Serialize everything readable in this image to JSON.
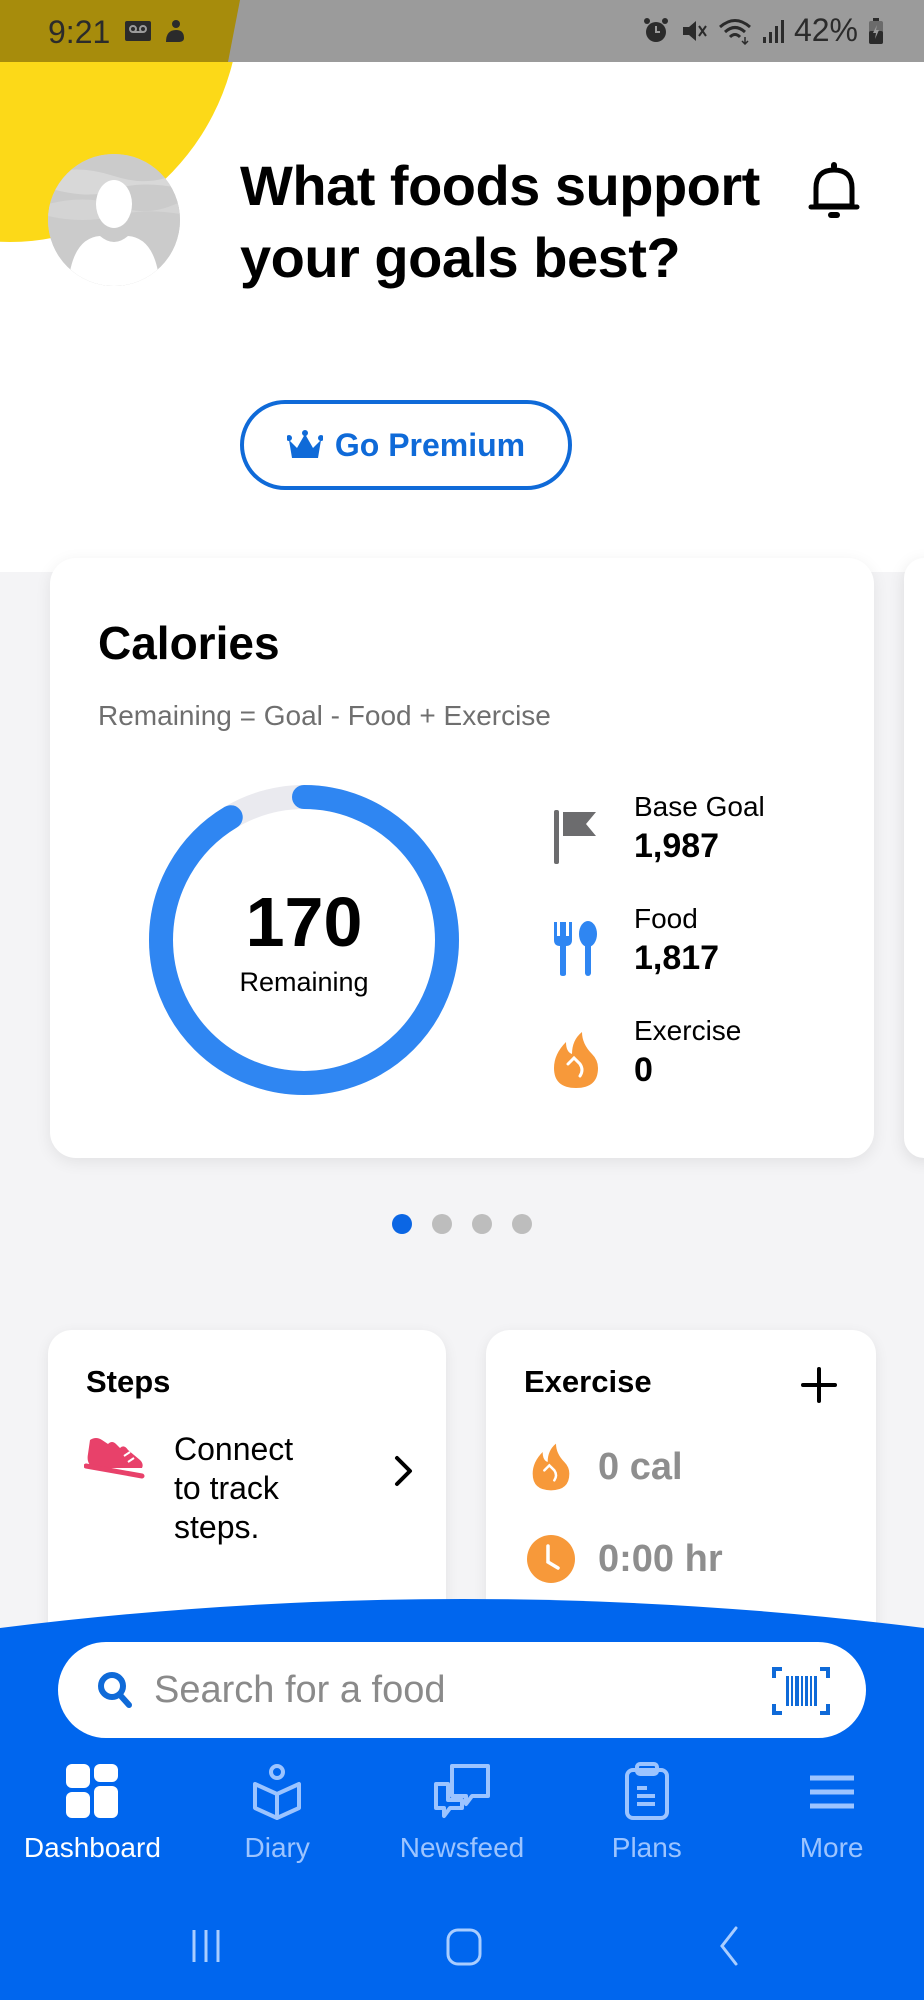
{
  "status_bar": {
    "time": "9:21",
    "left_icons": [
      "voicemail-icon",
      "notification-app-icon"
    ],
    "right_icons": [
      "alarm-icon",
      "mute-icon",
      "wifi-icon",
      "signal-icon"
    ],
    "battery": "42%"
  },
  "header": {
    "headline": "What foods support your goals best?",
    "premium_button": "Go Premium",
    "avatar": "avatar-placeholder",
    "notifications": "bell-icon"
  },
  "calories_card": {
    "title": "Calories",
    "formula": "Remaining = Goal - Food + Exercise",
    "remaining_value": "170",
    "remaining_label": "Remaining",
    "progress_fraction": 0.914,
    "stats": [
      {
        "icon": "flag-icon",
        "label": "Base Goal",
        "value": "1,987"
      },
      {
        "icon": "fork-spoon-icon",
        "label": "Food",
        "value": "1,817"
      },
      {
        "icon": "flame-icon",
        "label": "Exercise",
        "value": "0"
      }
    ]
  },
  "carousel": {
    "pages": 4,
    "active": 0
  },
  "steps_card": {
    "title": "Steps",
    "text": "Connect to track steps."
  },
  "exercise_card": {
    "title": "Exercise",
    "calories": "0 cal",
    "duration": "0:00 hr"
  },
  "search": {
    "placeholder": "Search for a food"
  },
  "nav": {
    "items": [
      {
        "label": "Dashboard",
        "icon": "dashboard-icon",
        "active": true
      },
      {
        "label": "Diary",
        "icon": "diary-icon",
        "active": false
      },
      {
        "label": "Newsfeed",
        "icon": "newsfeed-icon",
        "active": false
      },
      {
        "label": "Plans",
        "icon": "plans-icon",
        "active": false
      },
      {
        "label": "More",
        "icon": "menu-icon",
        "active": false
      }
    ]
  },
  "colors": {
    "brand_blue": "#0066ee",
    "ring_blue": "#2f86f2",
    "ring_track": "#eaeaef",
    "accent_yellow": "#fcd918",
    "exercise_orange": "#f7993a",
    "steps_pink": "#e8416a"
  }
}
